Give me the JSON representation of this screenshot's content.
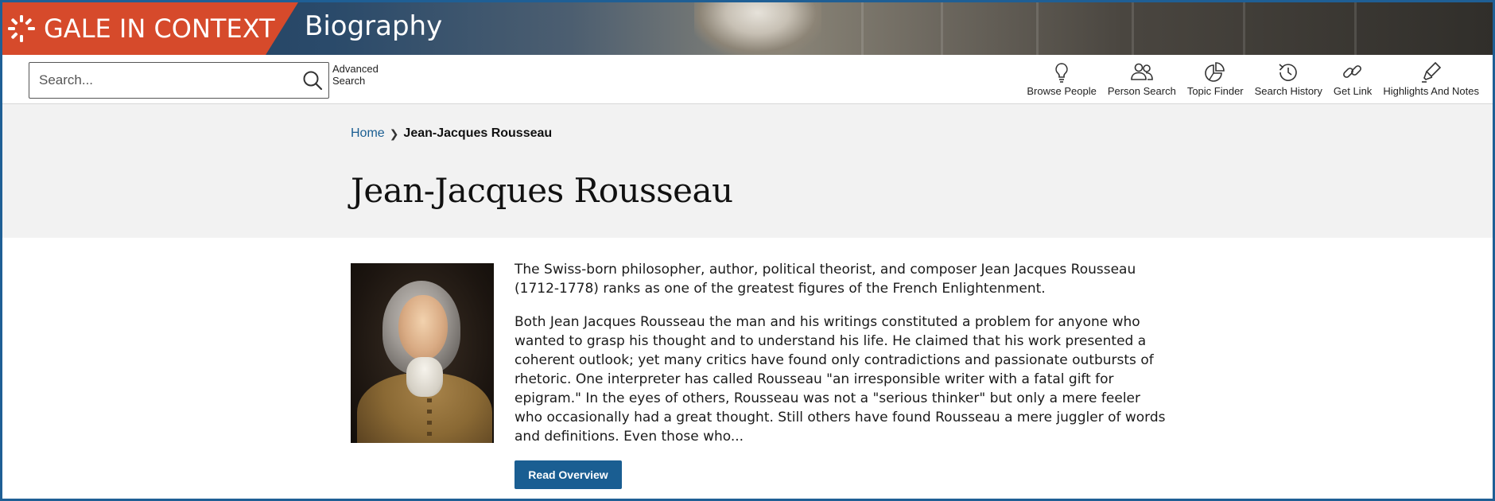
{
  "brand": {
    "name": "GALE IN CONTEXT",
    "product": "Biography",
    "logo_icon": "gale-burst-logo",
    "brand_color": "#d64a2b"
  },
  "search": {
    "placeholder": "Search...",
    "button_icon": "search-icon",
    "advanced_label": "Advanced Search"
  },
  "tools": [
    {
      "label": "Browse People",
      "icon": "lightbulb-icon"
    },
    {
      "label": "Person Search",
      "icon": "people-icon"
    },
    {
      "label": "Topic Finder",
      "icon": "pie-chart-icon"
    },
    {
      "label": "Search History",
      "icon": "history-icon"
    },
    {
      "label": "Get Link",
      "icon": "link-icon"
    },
    {
      "label": "Highlights And Notes",
      "icon": "highlighter-icon"
    }
  ],
  "breadcrumb": {
    "home": "Home",
    "current": "Jean-Jacques Rousseau"
  },
  "page": {
    "title": "Jean-Jacques Rousseau",
    "summary": "The Swiss-born philosopher, author, political theorist, and composer Jean Jacques Rousseau (1712-1778) ranks as one of the greatest figures of the French Enlightenment.",
    "overview": "Both Jean Jacques Rousseau the man and his writings constituted a problem for anyone who wanted to grasp his thought and to understand his life. He claimed that his work presented a coherent outlook; yet many critics have found only contradictions and passionate outbursts of rhetoric. One interpreter has called Rousseau \"an irresponsible writer with a fatal gift for epigram.\" In the eyes of others, Rousseau was not a \"serious thinker\" but only a mere feeler who occasionally had a great thought. Still others have found Rousseau a mere juggler of words and definitions. Even those who...",
    "read_button": "Read Overview",
    "accent_color": "#1a5e92"
  }
}
